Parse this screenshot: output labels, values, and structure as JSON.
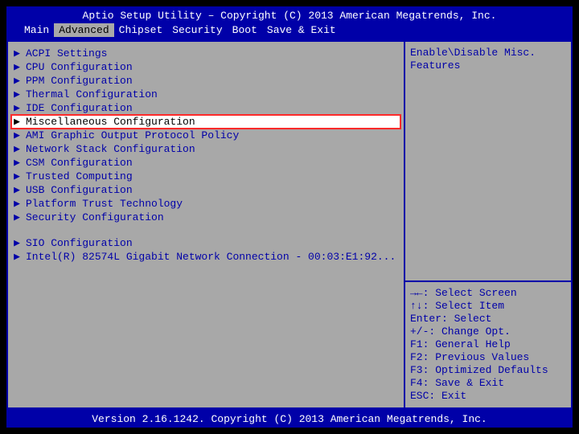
{
  "header": {
    "title": "Aptio Setup Utility – Copyright (C) 2013 American Megatrends, Inc."
  },
  "tabs": [
    {
      "label": "Main",
      "selected": false
    },
    {
      "label": "Advanced",
      "selected": true
    },
    {
      "label": "Chipset",
      "selected": false
    },
    {
      "label": "Security",
      "selected": false
    },
    {
      "label": "Boot",
      "selected": false
    },
    {
      "label": "Save & Exit",
      "selected": false
    }
  ],
  "menu": {
    "group1": [
      "ACPI Settings",
      "CPU Configuration",
      "PPM Configuration",
      "Thermal Configuration",
      "IDE Configuration",
      "Miscellaneous Configuration",
      "AMI Graphic Output Protocol Policy",
      "Network Stack Configuration",
      "CSM Configuration",
      "Trusted Computing",
      "USB Configuration",
      "Platform Trust Technology",
      "Security Configuration"
    ],
    "group2": [
      "SIO Configuration",
      "Intel(R) 82574L Gigabit Network Connection - 00:03:E1:92..."
    ],
    "selected_index": 5,
    "highlighted_index": 5
  },
  "help": {
    "description": "Enable\\Disable Misc. Features",
    "keys": [
      "→←: Select Screen",
      "↑↓: Select Item",
      "Enter: Select",
      "+/-: Change Opt.",
      "F1: General Help",
      "F2: Previous Values",
      "F3: Optimized Defaults",
      "F4: Save & Exit",
      "ESC: Exit"
    ]
  },
  "footer": {
    "text": "Version 2.16.1242. Copyright (C) 2013 American Megatrends, Inc."
  },
  "glyph": {
    "triangle": "▶"
  }
}
